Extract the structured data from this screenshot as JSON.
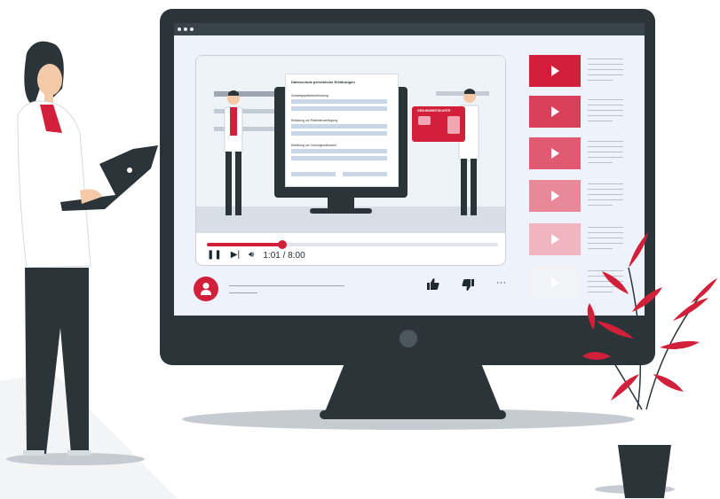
{
  "player": {
    "time_display": "1:01 / 8:00",
    "progress": 0.2604,
    "document": {
      "title": "Datenschutz persönliche Erklärungen",
      "sections": [
        "Schweigepflichtentbindung",
        "Erklärung zur Patientenverfügung",
        "Erklärung zur Vorsorgevollmacht"
      ]
    },
    "card_label": "GESUNDHEITSKARTE"
  },
  "icons": {
    "play": "play-icon",
    "pause": "pause-icon",
    "next": "skip-next-icon",
    "volume": "volume-icon",
    "like": "thumbs-up-icon",
    "dislike": "thumbs-down-icon",
    "more": "more-options-icon",
    "avatar": "user-icon"
  },
  "colors": {
    "accent": "#d2203a",
    "monitor": "#2b3438",
    "screen": "#eef3fb"
  },
  "playlist": [
    {
      "color": "#d2203a"
    },
    {
      "color": "#d9405a"
    },
    {
      "color": "#e05a72"
    },
    {
      "color": "#e8899a"
    },
    {
      "color": "#f1b5c0"
    },
    {
      "color": "#f1f3f6"
    }
  ]
}
